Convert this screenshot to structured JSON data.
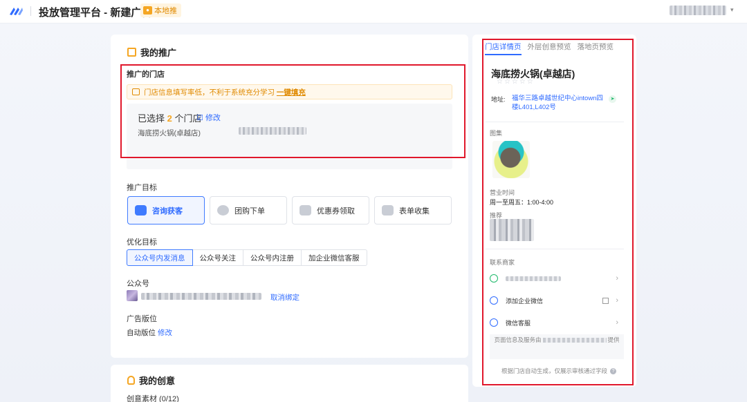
{
  "header": {
    "title": "投放管理平台 - 新建广告",
    "tag": "本地推",
    "tag_icon": "store-tag-icon",
    "user_menu": "blurred-account-name"
  },
  "promotion": {
    "title": "我的推广",
    "store_label": "推广的门店",
    "warning_text": "门店信息填写率低，不利于系统充分学习",
    "warning_link": "一键填充",
    "selected_prefix": "已选择",
    "selected_count": "2",
    "selected_suffix": "个门店",
    "edit_label": "修改",
    "store_name": "海底捞火锅(卓越店)",
    "goal_label": "推广目标",
    "goals": [
      {
        "label": "咨询获客",
        "icon": "chat-icon",
        "active": true
      },
      {
        "label": "团购下单",
        "icon": "groupbuy-icon",
        "active": false
      },
      {
        "label": "优惠券领取",
        "icon": "coupon-icon",
        "active": false
      },
      {
        "label": "表单收集",
        "icon": "form-icon",
        "active": false
      }
    ],
    "opt_label": "优化目标",
    "opt_tabs": [
      {
        "label": "公众号内发消息",
        "active": true
      },
      {
        "label": "公众号关注",
        "active": false
      },
      {
        "label": "公众号内注册",
        "active": false
      },
      {
        "label": "加企业微信客服",
        "active": false
      }
    ],
    "gzh_label": "公众号",
    "unbind_label": "取消绑定",
    "adpos_label": "广告版位",
    "adpos_value": "自动版位",
    "adpos_edit": "修改"
  },
  "creative": {
    "title": "我的创意",
    "material_label": "创意素材 (0/12)"
  },
  "preview": {
    "tabs": [
      {
        "label": "门店详情页",
        "active": true
      },
      {
        "label": "外层创意预览",
        "active": false
      },
      {
        "label": "落地页预览",
        "active": false
      }
    ],
    "shop_name": "海底捞火锅(卓越店)",
    "stars": "☆☆☆☆☆",
    "addr_label": "地址:",
    "addr": "福华三路卓越世纪中心intown四楼L401,L402号",
    "gallery_label": "图集",
    "hours_label": "营业时间",
    "hours": "周一至周五：1:00-4:00",
    "recommend_label": "推荐",
    "contact_label": "联系商家",
    "contacts": [
      {
        "label": "",
        "icon": "phone-icon"
      },
      {
        "label": "添加企业微信",
        "icon": "wecom-icon"
      },
      {
        "label": "微信客服",
        "icon": "wechat-service-icon"
      }
    ],
    "provided_prefix": "页面信息及服务由",
    "provided_suffix": "提供",
    "footnote": "根据门店自动生成，仅展示审核通过字段"
  },
  "colors": {
    "accent": "#2f6bff",
    "warning": "#e08a00",
    "highlight_box": "#e0172b"
  }
}
